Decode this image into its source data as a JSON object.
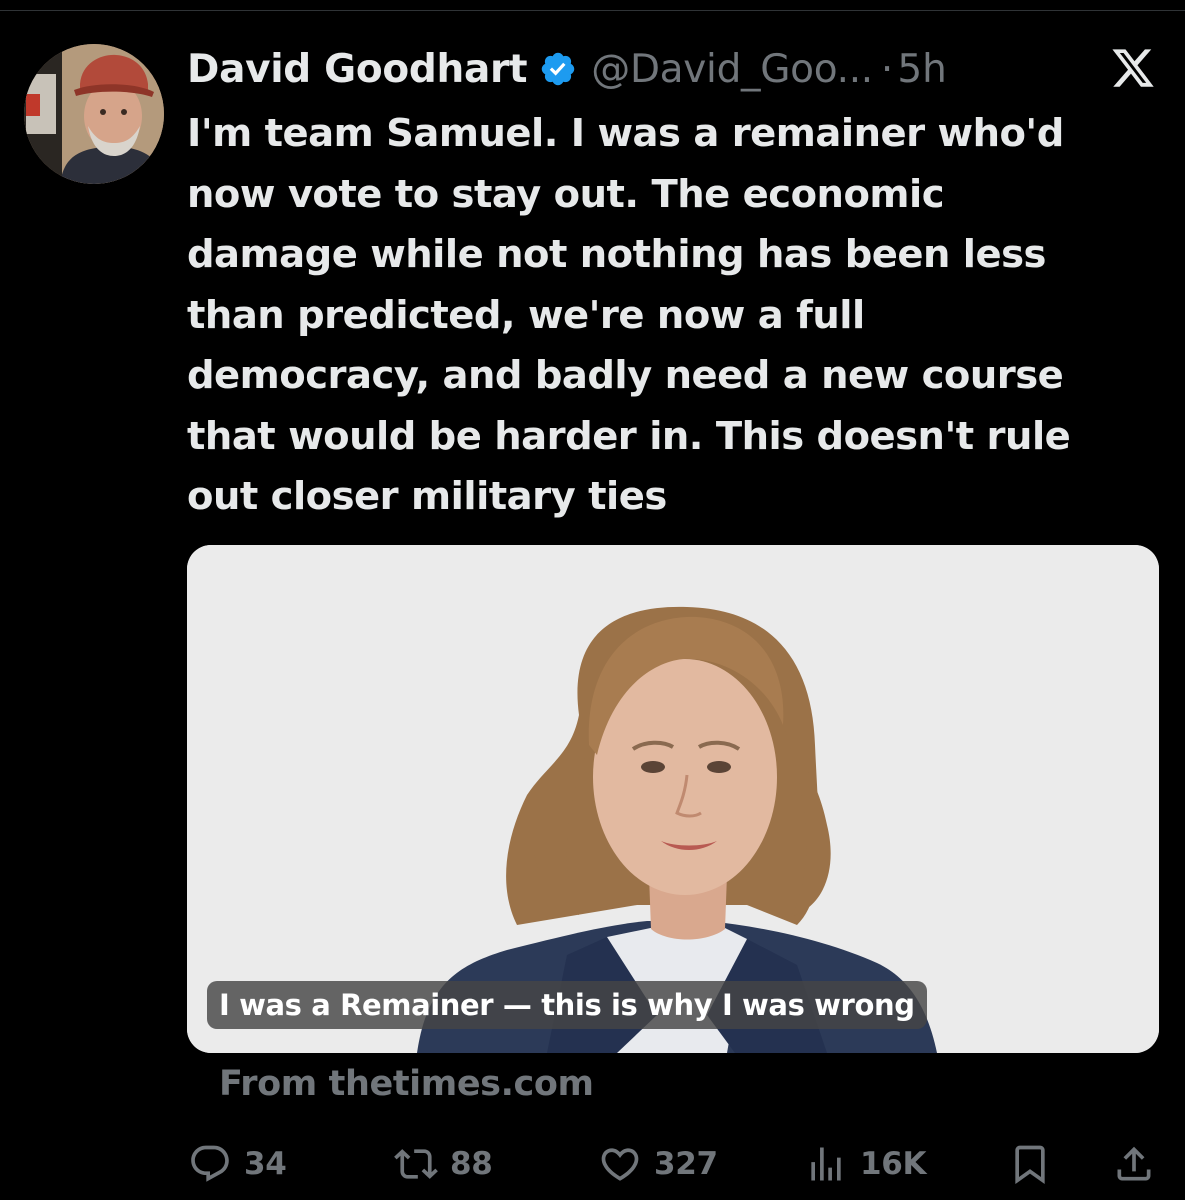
{
  "tweet": {
    "author_name": "David Goodhart",
    "handle": "@David_Goo...",
    "separator": "·",
    "time": "5h",
    "text_lines": [
      "I'm team Samuel. I was a remainer who'd",
      "now vote to stay out. The economic",
      "damage while not nothing has been less",
      "than predicted, we're now a full",
      "democracy, and badly need a new course",
      "that would be harder in. This doesn't rule",
      "out closer military ties"
    ]
  },
  "card": {
    "caption": "I was a Remainer — this is why I was wrong",
    "source": "From thetimes.com"
  },
  "actions": {
    "replies": "34",
    "reposts": "88",
    "likes": "327",
    "views": "16K"
  },
  "icons": {
    "verified": "verified-badge-icon",
    "x_logo": "x-logo-icon",
    "reply": "reply-icon",
    "repost": "repost-icon",
    "like": "heart-icon",
    "views": "views-icon",
    "bookmark": "bookmark-icon",
    "share": "share-icon"
  },
  "colors": {
    "background": "#000000",
    "text": "#e7e9ea",
    "muted": "#71767b",
    "verified_blue": "#1d9bf0"
  }
}
